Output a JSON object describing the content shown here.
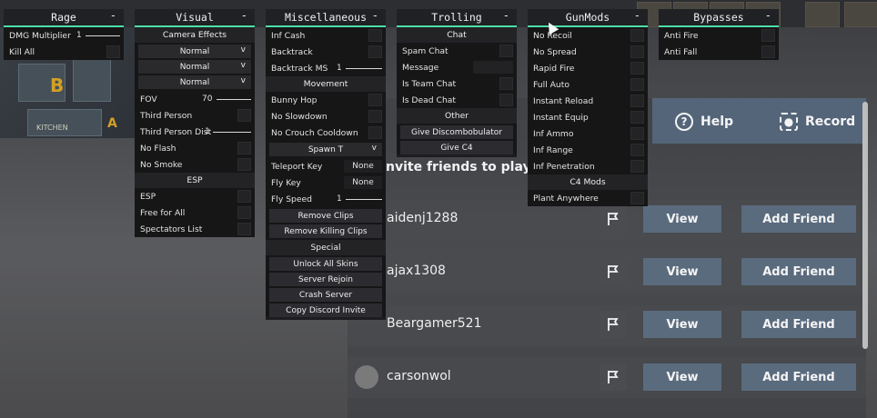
{
  "colors": {
    "accent": "#4ce0a8",
    "panel": "#161617",
    "button_blue": "#5a6b7e"
  },
  "windows": {
    "rage": {
      "title": "Rage",
      "minimize": "-",
      "dmg_label": "DMG Multiplier",
      "dmg_value": "1",
      "killall_label": "Kill All"
    },
    "visual": {
      "title": "Visual",
      "minimize": "-",
      "camera_effects": "Camera Effects",
      "dropdowns": [
        {
          "value": "Normal",
          "arrow": "v"
        },
        {
          "value": "Normal",
          "arrow": "v"
        },
        {
          "value": "Normal",
          "arrow": "v"
        }
      ],
      "fov_label": "FOV",
      "fov_value": "70",
      "third_person": "Third Person",
      "third_person_dist": "Third Person Dist",
      "third_person_dist_value": "1",
      "no_flash": "No Flash",
      "no_smoke": "No Smoke",
      "esp_section": "ESP",
      "esp": "ESP",
      "free_for_all": "Free for All",
      "spectators_list": "Spectators List"
    },
    "misc": {
      "title": "Miscellaneous",
      "minimize": "-",
      "inf_cash": "Inf Cash",
      "backtrack": "Backtrack",
      "backtrack_ms": "Backtrack MS",
      "backtrack_ms_value": "1",
      "movement": "Movement",
      "bunny_hop": "Bunny Hop",
      "no_slowdown": "No Slowdown",
      "no_crouch": "No Crouch Cooldown",
      "spawn_dropdown": "Spawn T",
      "spawn_arrow": "v",
      "teleport_key": "Teleport Key",
      "teleport_key_value": "None",
      "fly_key": "Fly Key",
      "fly_key_value": "None",
      "fly_speed": "Fly Speed",
      "fly_speed_value": "1",
      "remove_clips": "Remove Clips",
      "remove_killing_clips": "Remove Killing Clips",
      "special": "Special",
      "unlock_all_skins": "Unlock All Skins",
      "server_rejoin": "Server Rejoin",
      "crash_server": "Crash Server",
      "copy_discord": "Copy Discord Invite"
    },
    "trolling": {
      "title": "Trolling",
      "minimize": "-",
      "chat": "Chat",
      "spam_chat": "Spam Chat",
      "message": "Message",
      "is_team_chat": "Is Team Chat",
      "is_dead_chat": "Is Dead Chat",
      "other": "Other",
      "give_discombobulator": "Give Discombobulator",
      "give_c4": "Give C4"
    },
    "gunmods": {
      "title": "GunMods",
      "minimize": "-",
      "items": [
        "No Recoil",
        "No Spread",
        "Rapid Fire",
        "Full Auto",
        "Instant Reload",
        "Instant Equip",
        "Inf Ammo",
        "Inf Range",
        "Inf Penetration"
      ],
      "c4_mods": "C4 Mods",
      "plant_anywhere": "Plant Anywhere"
    },
    "bypasses": {
      "title": "Bypasses",
      "minimize": "-",
      "anti_fire": "Anti Fire",
      "anti_fall": "Anti Fall"
    }
  },
  "social": {
    "help": "Help",
    "record": "Record",
    "invite_text": "nvite friends to play",
    "friends": [
      {
        "name": "aidenj1288",
        "view": "View",
        "add": "Add Friend"
      },
      {
        "name": "ajax1308",
        "view": "View",
        "add": "Add Friend"
      },
      {
        "name": "Beargamer521",
        "view": "View",
        "add": "Add Friend"
      },
      {
        "name": "carsonwol",
        "view": "View",
        "add": "Add Friend"
      }
    ]
  },
  "map": {
    "kitchen_label": "KITCHEN",
    "letter_b": "B",
    "letter_a": "A"
  }
}
